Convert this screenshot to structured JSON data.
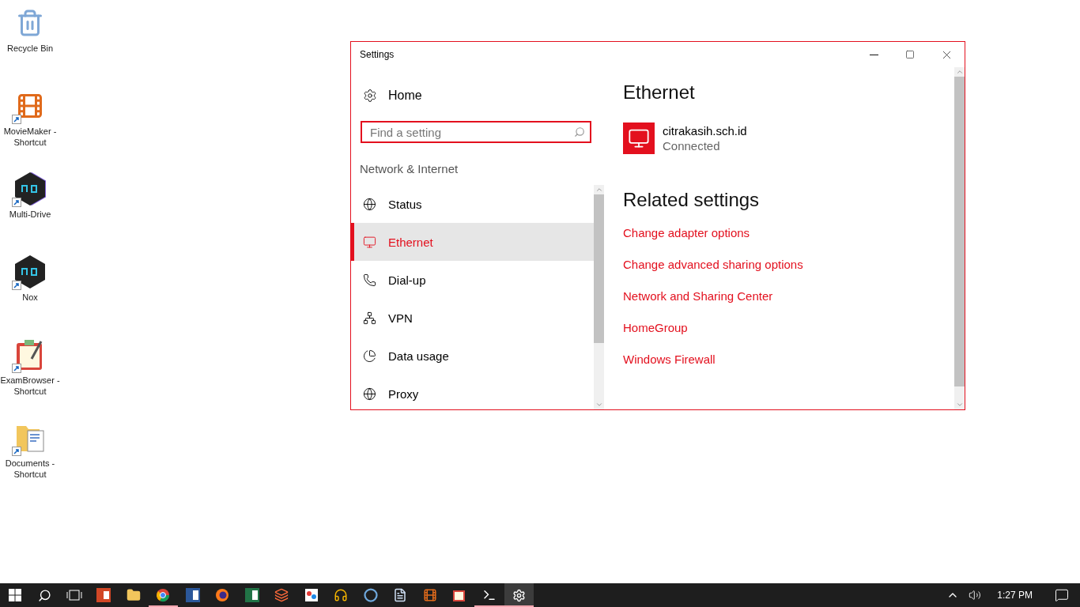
{
  "desktop_icons": [
    {
      "kind": "recycle",
      "label": "Recycle Bin",
      "shortcut": false
    },
    {
      "kind": "film",
      "label": "MovieMaker - Shortcut",
      "shortcut": true
    },
    {
      "kind": "hexagon-multi",
      "label": "Multi-Drive",
      "shortcut": true
    },
    {
      "kind": "hexagon",
      "label": "Nox",
      "shortcut": true
    },
    {
      "kind": "notebook",
      "label": "ExamBrowser - Shortcut",
      "shortcut": true
    },
    {
      "kind": "folder-doc",
      "label": "Documents - Shortcut",
      "shortcut": true
    }
  ],
  "window": {
    "title": "Settings"
  },
  "sidebar": {
    "home": "Home",
    "search": {
      "placeholder": "Find a setting"
    },
    "section": "Network & Internet",
    "items": [
      {
        "kind": "status",
        "label": "Status",
        "selected": false
      },
      {
        "kind": "ethernet",
        "label": "Ethernet",
        "selected": true
      },
      {
        "kind": "dialup",
        "label": "Dial-up",
        "selected": false
      },
      {
        "kind": "vpn",
        "label": "VPN",
        "selected": false
      },
      {
        "kind": "data",
        "label": "Data usage",
        "selected": false
      },
      {
        "kind": "proxy",
        "label": "Proxy",
        "selected": false
      }
    ]
  },
  "content": {
    "title": "Ethernet",
    "connection": {
      "name": "citrakasih.sch.id",
      "status": "Connected"
    },
    "related_title": "Related settings",
    "links": [
      "Change adapter options",
      "Change advanced sharing options",
      "Network and Sharing Center",
      "HomeGroup",
      "Windows Firewall"
    ]
  },
  "taskbar": {
    "apps": [
      {
        "kind": "slides",
        "running": false,
        "selected": false
      },
      {
        "kind": "folder",
        "running": false,
        "selected": false
      },
      {
        "kind": "browser-ball",
        "running": true,
        "selected": false
      },
      {
        "kind": "doc-blue",
        "running": false,
        "selected": false
      },
      {
        "kind": "browser-fox",
        "running": false,
        "selected": false
      },
      {
        "kind": "sheet",
        "running": false,
        "selected": false
      },
      {
        "kind": "windows-stack",
        "running": false,
        "selected": false
      },
      {
        "kind": "paint",
        "running": false,
        "selected": false
      },
      {
        "kind": "headset",
        "running": false,
        "selected": false
      },
      {
        "kind": "ring",
        "running": false,
        "selected": false
      },
      {
        "kind": "page",
        "running": false,
        "selected": false
      },
      {
        "kind": "film",
        "running": false,
        "selected": false
      },
      {
        "kind": "notebook",
        "running": false,
        "selected": false
      },
      {
        "kind": "terminal",
        "running": true,
        "selected": false
      },
      {
        "kind": "gear",
        "running": true,
        "selected": true
      }
    ],
    "time": "1:27 PM"
  }
}
